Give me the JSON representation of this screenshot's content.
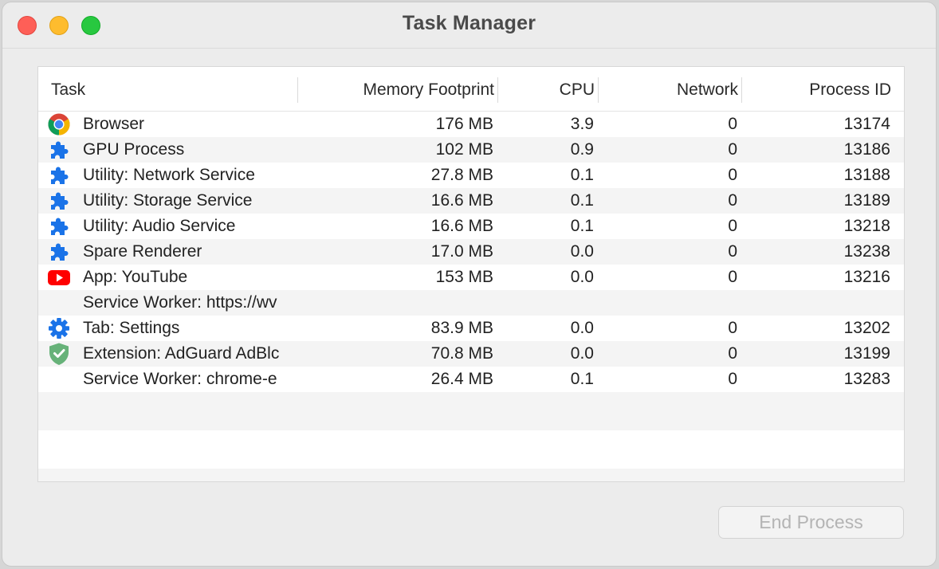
{
  "window": {
    "title": "Task Manager"
  },
  "columns": {
    "task": "Task",
    "memory": "Memory Footprint",
    "cpu": "CPU",
    "network": "Network",
    "pid": "Process ID"
  },
  "rows": [
    {
      "icon": "chrome-icon",
      "name": "Browser",
      "memory": "176 MB",
      "cpu": "3.9",
      "network": "0",
      "pid": "13174"
    },
    {
      "icon": "puzzle-icon",
      "name": "GPU Process",
      "memory": "102 MB",
      "cpu": "0.9",
      "network": "0",
      "pid": "13186"
    },
    {
      "icon": "puzzle-icon",
      "name": "Utility: Network Service",
      "memory": "27.8 MB",
      "cpu": "0.1",
      "network": "0",
      "pid": "13188"
    },
    {
      "icon": "puzzle-icon",
      "name": "Utility: Storage Service",
      "memory": "16.6 MB",
      "cpu": "0.1",
      "network": "0",
      "pid": "13189"
    },
    {
      "icon": "puzzle-icon",
      "name": "Utility: Audio Service",
      "memory": "16.6 MB",
      "cpu": "0.1",
      "network": "0",
      "pid": "13218"
    },
    {
      "icon": "puzzle-icon",
      "name": "Spare Renderer",
      "memory": "17.0 MB",
      "cpu": "0.0",
      "network": "0",
      "pid": "13238"
    },
    {
      "icon": "youtube-icon",
      "name": "App: YouTube",
      "memory": "153 MB",
      "cpu": "0.0",
      "network": "0",
      "pid": "13216"
    },
    {
      "icon": "",
      "name": "Service Worker: https://wv",
      "memory": "",
      "cpu": "",
      "network": "",
      "pid": ""
    },
    {
      "icon": "gear-icon",
      "name": "Tab: Settings",
      "memory": "83.9 MB",
      "cpu": "0.0",
      "network": "0",
      "pid": "13202"
    },
    {
      "icon": "shield-check-icon",
      "name": "Extension: AdGuard AdBlc",
      "memory": "70.8 MB",
      "cpu": "0.0",
      "network": "0",
      "pid": "13199"
    },
    {
      "icon": "",
      "name": "Service Worker: chrome-e",
      "memory": "26.4 MB",
      "cpu": "0.1",
      "network": "0",
      "pid": "13283"
    }
  ],
  "buttons": {
    "end_process": "End Process"
  },
  "colors": {
    "close": "#fe5f57",
    "minimize": "#febc2e",
    "maximize": "#28c840",
    "puzzle": "#1a73e8",
    "youtube": "#ff0000",
    "adguard": "#67b279"
  }
}
